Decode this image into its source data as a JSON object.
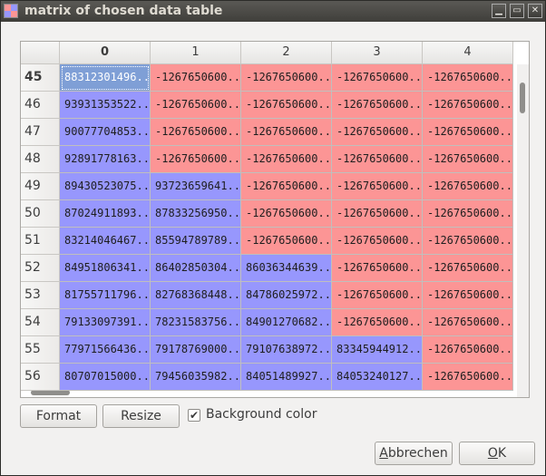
{
  "window": {
    "title": "matrix of chosen data table",
    "minimize_glyph": "▁",
    "maximize_glyph": "▭",
    "close_glyph": "✕"
  },
  "table": {
    "column_headers": [
      "0",
      "1",
      "2",
      "3",
      "4"
    ],
    "active_column": 0,
    "rows": [
      {
        "label": "45",
        "cells": [
          "88312301496...",
          "-1267650600...",
          "-1267650600...",
          "-1267650600...",
          "-1267650600..."
        ],
        "colors": [
          "selected",
          "red",
          "red",
          "red",
          "red"
        ]
      },
      {
        "label": "46",
        "cells": [
          "93931353522...",
          "-1267650600...",
          "-1267650600...",
          "-1267650600...",
          "-1267650600..."
        ],
        "colors": [
          "blue",
          "red",
          "red",
          "red",
          "red"
        ]
      },
      {
        "label": "47",
        "cells": [
          "90077704853...",
          "-1267650600...",
          "-1267650600...",
          "-1267650600...",
          "-1267650600..."
        ],
        "colors": [
          "blue",
          "red",
          "red",
          "red",
          "red"
        ]
      },
      {
        "label": "48",
        "cells": [
          "92891778163...",
          "-1267650600...",
          "-1267650600...",
          "-1267650600...",
          "-1267650600..."
        ],
        "colors": [
          "blue",
          "red",
          "red",
          "red",
          "red"
        ]
      },
      {
        "label": "49",
        "cells": [
          "89430523075...",
          "93723659641...",
          "-1267650600...",
          "-1267650600...",
          "-1267650600..."
        ],
        "colors": [
          "blue",
          "blue",
          "red",
          "red",
          "red"
        ]
      },
      {
        "label": "50",
        "cells": [
          "87024911893...",
          "87833256950...",
          "-1267650600...",
          "-1267650600...",
          "-1267650600..."
        ],
        "colors": [
          "blue",
          "blue",
          "red",
          "red",
          "red"
        ]
      },
      {
        "label": "51",
        "cells": [
          "83214046467...",
          "85594789789...",
          "-1267650600...",
          "-1267650600...",
          "-1267650600..."
        ],
        "colors": [
          "blue",
          "blue",
          "red",
          "red",
          "red"
        ]
      },
      {
        "label": "52",
        "cells": [
          "84951806341...",
          "86402850304...",
          "86036344639...",
          "-1267650600...",
          "-1267650600..."
        ],
        "colors": [
          "blue",
          "blue",
          "blue",
          "red",
          "red"
        ]
      },
      {
        "label": "53",
        "cells": [
          "81755711796...",
          "82768368448...",
          "84786025972...",
          "-1267650600...",
          "-1267650600..."
        ],
        "colors": [
          "blue",
          "blue",
          "blue",
          "red",
          "red"
        ]
      },
      {
        "label": "54",
        "cells": [
          "79133097391...",
          "78231583756...",
          "84901270682...",
          "-1267650600...",
          "-1267650600..."
        ],
        "colors": [
          "blue",
          "blue",
          "blue",
          "red",
          "red"
        ]
      },
      {
        "label": "55",
        "cells": [
          "77971566436...",
          "79178769000...",
          "79107638972...",
          "83345944912...",
          "-1267650600..."
        ],
        "colors": [
          "blue",
          "blue",
          "blue",
          "blue",
          "red"
        ]
      },
      {
        "label": "56",
        "cells": [
          "80707015000...",
          "79456035982...",
          "84051489927...",
          "84053240127...",
          "-1267650600..."
        ],
        "colors": [
          "blue",
          "blue",
          "blue",
          "blue",
          "red"
        ]
      }
    ],
    "active_row": 0
  },
  "controls": {
    "format_label": "Format",
    "resize_label": "Resize",
    "background_color_label": "Background color",
    "background_color_checked": true,
    "check_glyph": "✔"
  },
  "dialog_buttons": {
    "cancel_label": "Abbrechen",
    "ok_label": "OK"
  },
  "colors": {
    "cell_blue": "#9797fd",
    "cell_red": "#fc9595",
    "cell_selected": "#7f9fd6"
  }
}
